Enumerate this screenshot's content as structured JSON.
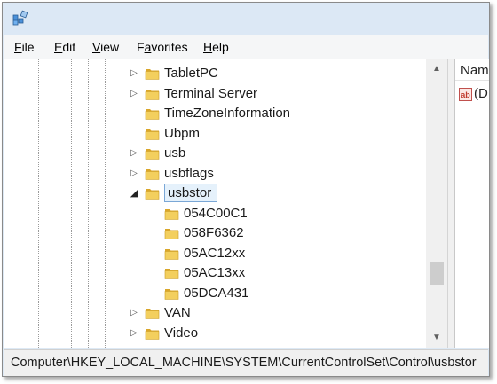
{
  "window": {
    "app_icon": "registry-editor-icon"
  },
  "menu": [
    {
      "accel": "F",
      "rest": "ile"
    },
    {
      "accel": "E",
      "rest": "dit"
    },
    {
      "accel": "V",
      "rest": "iew"
    },
    {
      "accel": "a",
      "prefix": "F",
      "rest": "vorites"
    },
    {
      "accel": "H",
      "rest": "elp"
    }
  ],
  "tree": {
    "items": [
      {
        "label": "TabletPC",
        "expandable": true
      },
      {
        "label": "Terminal Server",
        "expandable": true
      },
      {
        "label": "TimeZoneInformation",
        "expandable": false
      },
      {
        "label": "Ubpm",
        "expandable": false
      },
      {
        "label": "usb",
        "expandable": true
      },
      {
        "label": "usbflags",
        "expandable": true
      },
      {
        "label": "usbstor",
        "expandable": true,
        "expanded": true,
        "selected": true
      },
      {
        "label": "054C00C1",
        "child": true
      },
      {
        "label": "058F6362",
        "child": true
      },
      {
        "label": "05AC12xx",
        "child": true
      },
      {
        "label": "05AC13xx",
        "child": true
      },
      {
        "label": "05DCA431",
        "child": true
      },
      {
        "label": "VAN",
        "expandable": true
      },
      {
        "label": "Video",
        "expandable": true
      }
    ]
  },
  "values_pane": {
    "column_header": "Name",
    "rows": [
      {
        "icon": "string-value-icon",
        "icon_text": "ab",
        "name": "(D"
      }
    ]
  },
  "status": {
    "path": "Computer\\HKEY_LOCAL_MACHINE\\SYSTEM\\CurrentControlSet\\Control\\usbstor"
  },
  "colors": {
    "folder": "#e8b93a",
    "selection_border": "#7aa7d6",
    "selection_fill": "#e5f1fb",
    "titlebar": "#dce8f5"
  }
}
